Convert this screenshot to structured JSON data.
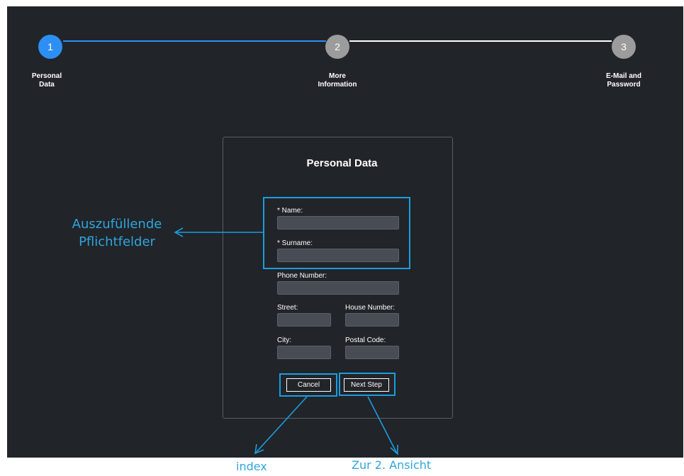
{
  "stepper": {
    "steps": [
      {
        "number": "1",
        "label_line1": "Personal",
        "label_line2": "Data"
      },
      {
        "number": "2",
        "label_line1": "More",
        "label_line2": "Information"
      },
      {
        "number": "3",
        "label_line1": "E-Mail and",
        "label_line2": "Password"
      }
    ],
    "active_step": 1,
    "colors": {
      "active": "#2d8ff4",
      "inactive": "#9c9c9c",
      "line_active": "#2d8ff4",
      "line_inactive": "#ffffff"
    }
  },
  "form": {
    "title": "Personal Data",
    "fields": {
      "name": {
        "label": "* Name:",
        "value": ""
      },
      "surname": {
        "label": "* Surname:",
        "value": ""
      },
      "phone": {
        "label": "Phone Number:",
        "value": ""
      },
      "street": {
        "label": "Street:",
        "value": ""
      },
      "house_number": {
        "label": "House Number:",
        "value": ""
      },
      "city": {
        "label": "City:",
        "value": ""
      },
      "postal_code": {
        "label": "Postal Code:",
        "value": ""
      }
    },
    "buttons": {
      "cancel": "Cancel",
      "next": "Next Step"
    }
  },
  "annotations": {
    "required_line1": "Auszufüllende",
    "required_line2": "Pflichtfelder",
    "cancel_target": "index",
    "next_target": "Zur 2. Ansicht",
    "color": "#1c9ddf"
  }
}
